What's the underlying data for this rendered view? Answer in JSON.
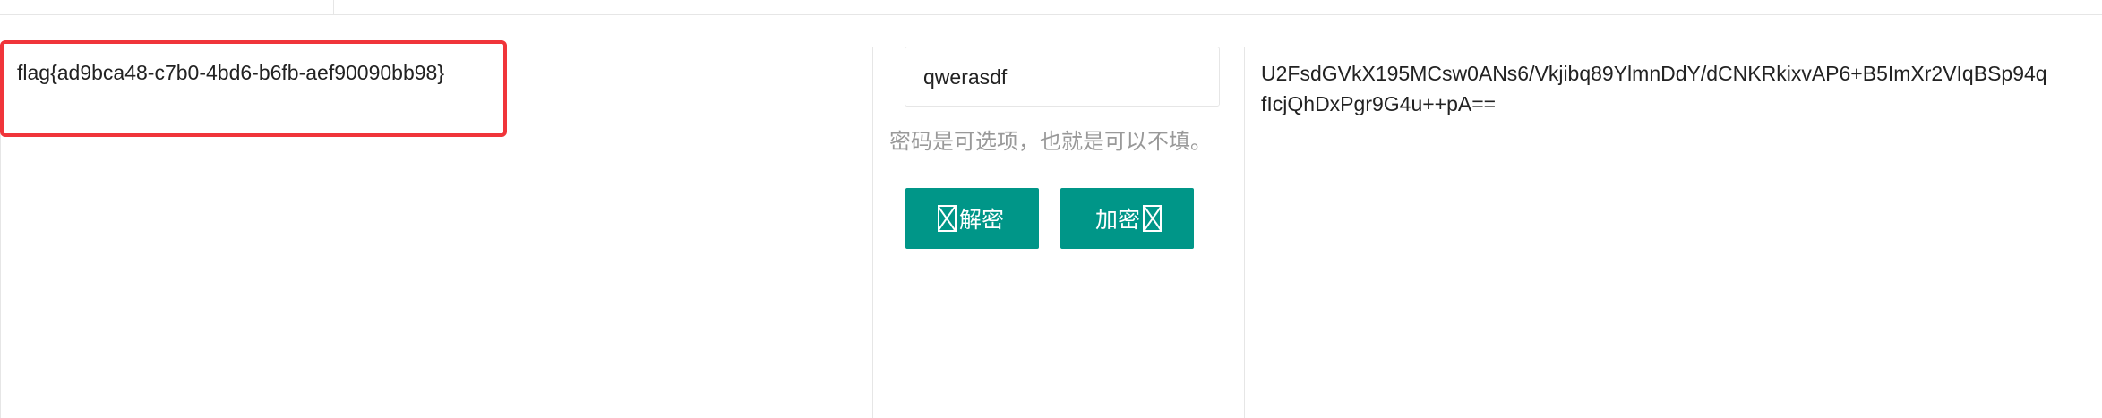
{
  "plaintext": "flag{ad9bca48-c7b0-4bd6-b6fb-aef90090bb98}",
  "password": {
    "value": "qwerasdf",
    "hint": "密码是可选项，也就是可以不填。"
  },
  "buttons": {
    "decrypt_label": "解密",
    "encrypt_label": "加密",
    "decrypt_icon": "missing-glyph-box",
    "encrypt_icon": "missing-glyph-box"
  },
  "ciphertext": {
    "line1": "U2FsdGVkX195MCsw0ANs6/Vkjibq89YlmnDdY/dCNKRkixvAP6+B5ImXr2VIqBSp94q",
    "line2": "fIcjQhDxPgr9G4u++pA=="
  },
  "colors": {
    "button": "#009688",
    "highlight": "#f0353a",
    "hint": "#999999",
    "border": "#e6e6e6"
  }
}
